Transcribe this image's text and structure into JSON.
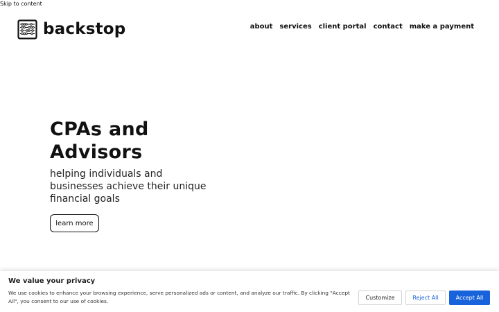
{
  "skip_link": "Skip to content",
  "brand": {
    "name": "backstop",
    "icon": "abacus-icon"
  },
  "nav": {
    "items": [
      {
        "label": "about"
      },
      {
        "label": "services"
      },
      {
        "label": "client portal"
      },
      {
        "label": "contact"
      },
      {
        "label": "make a payment"
      }
    ]
  },
  "hero": {
    "title": "CPAs and Advisors",
    "subtitle": "helping individuals and businesses achieve their unique financial goals",
    "button_label": "learn more"
  },
  "cookie": {
    "title": "We value your privacy",
    "text": "We use cookies to enhance your browsing experience, serve personalized ads or content, and analyze our traffic. By clicking \"Accept All\", you consent to our use of cookies.",
    "customize_label": "Customize",
    "reject_label": "Reject All",
    "accept_label": "Accept All"
  },
  "colors": {
    "accent": "#1863dc",
    "text": "#111111",
    "background": "#ffffff"
  }
}
